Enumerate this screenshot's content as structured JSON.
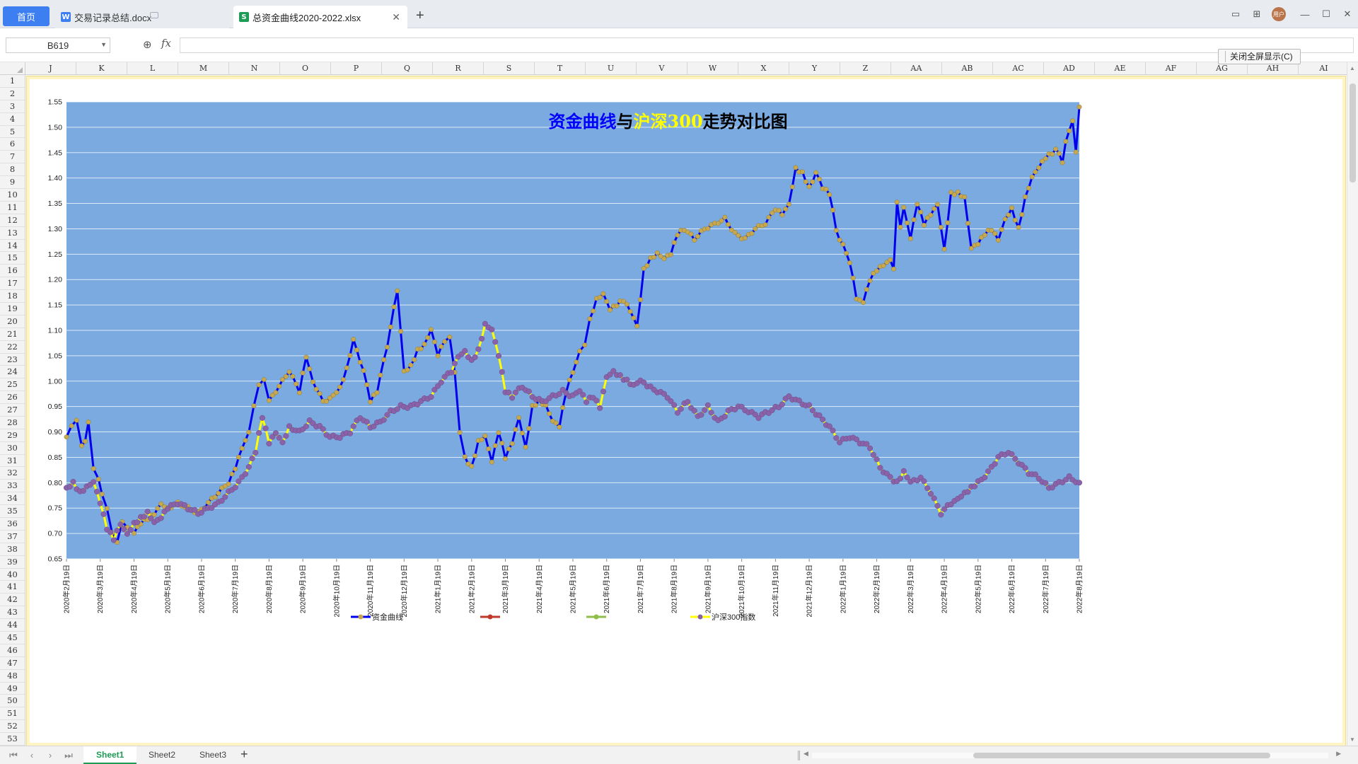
{
  "tabs": {
    "home": "首页",
    "doc": "交易记录总结.docx",
    "xls": "总资金曲线2020-2022.xlsx",
    "doc_badge": "W",
    "xls_badge": "S"
  },
  "window": {
    "avatar_text": "用户"
  },
  "formula_bar": {
    "name_box": "B619",
    "fx": "fx",
    "value": ""
  },
  "exit_fullscreen": "关闭全屏显示(C)",
  "columns": [
    "J",
    "K",
    "L",
    "M",
    "N",
    "O",
    "P",
    "Q",
    "R",
    "S",
    "T",
    "U",
    "V",
    "W",
    "X",
    "Y",
    "Z",
    "AA",
    "AB",
    "AC",
    "AD",
    "AE",
    "AF",
    "AG",
    "AH",
    "AI"
  ],
  "rows": [
    "1",
    "2",
    "3",
    "4",
    "5",
    "6",
    "7",
    "8",
    "9",
    "10",
    "11",
    "12",
    "13",
    "14",
    "15",
    "16",
    "17",
    "18",
    "19",
    "20",
    "21",
    "22",
    "23",
    "24",
    "25",
    "26",
    "27",
    "28",
    "29",
    "30",
    "31",
    "32",
    "33",
    "34",
    "35",
    "36",
    "37",
    "38",
    "39",
    "40",
    "41",
    "42",
    "43",
    "44",
    "45",
    "46",
    "47",
    "48",
    "49",
    "50",
    "51",
    "52",
    "53"
  ],
  "sheets": [
    "Sheet1",
    "Sheet2",
    "Sheet3"
  ],
  "colors": {
    "plot_bg": "#7aaae0",
    "fund_line": "#0000ee",
    "fund_marker": "#c8a84e",
    "index_line": "#ffff00",
    "index_marker": "#8a62a8",
    "title_blue": "#0000ff",
    "title_yellow": "#ffff00",
    "title_black": "#000000",
    "series2": "#c0392b",
    "series3": "#8fbf4a"
  },
  "chart_data": {
    "type": "line",
    "title_parts": [
      "资金曲线",
      "与",
      "沪深300",
      "走势对比图"
    ],
    "ylim": [
      0.65,
      1.55
    ],
    "y_ticks": [
      "1.55",
      "1.50",
      "1.45",
      "1.40",
      "1.35",
      "1.30",
      "1.25",
      "1.20",
      "1.15",
      "1.10",
      "1.05",
      "1.00",
      "0.95",
      "0.90",
      "0.85",
      "0.80",
      "0.75",
      "0.70",
      "0.65"
    ],
    "x_labels": [
      "2020年2月19日",
      "2020年3月19日",
      "2020年4月19日",
      "2020年5月19日",
      "2020年6月19日",
      "2020年7月19日",
      "2020年8月19日",
      "2020年9月19日",
      "2020年10月19日",
      "2020年11月19日",
      "2020年12月19日",
      "2021年1月19日",
      "2021年2月19日",
      "2021年3月19日",
      "2021年4月19日",
      "2021年5月19日",
      "2021年6月19日",
      "2021年7月19日",
      "2021年8月19日",
      "2021年9月19日",
      "2021年10月19日",
      "2021年11月19日",
      "2021年12月19日",
      "2022年1月19日",
      "2022年2月19日",
      "2022年3月19日",
      "2022年4月19日",
      "2022年5月19日",
      "2022年6月19日",
      "2022年7月19日",
      "2022年8月19日"
    ],
    "legend": [
      {
        "name": "资金曲线",
        "line": "#0000ee",
        "marker": "#c8a84e"
      },
      {
        "name": "",
        "line": "#c0392b",
        "marker": "#c0392b"
      },
      {
        "name": "",
        "line": "#8fbf4a",
        "marker": "#8fbf4a"
      },
      {
        "name": "沪深300指数",
        "line": "#ffff00",
        "marker": "#8a62a8"
      }
    ],
    "series": [
      {
        "name": "资金曲线",
        "x_month": [
          0,
          0.15,
          0.3,
          0.45,
          0.55,
          0.65,
          0.8,
          0.95,
          1.05,
          1.2,
          1.35,
          1.5,
          1.65,
          1.8,
          2.0,
          2.2,
          2.4,
          2.6,
          2.8,
          3.0,
          3.3,
          3.6,
          3.9,
          4.2,
          4.5,
          4.8,
          5.0,
          5.2,
          5.4,
          5.55,
          5.7,
          5.85,
          6.0,
          6.3,
          6.6,
          6.9,
          7.1,
          7.3,
          7.6,
          7.9,
          8.2,
          8.5,
          8.8,
          9.0,
          9.2,
          9.5,
          9.8,
          10.0,
          10.2,
          10.4,
          10.6,
          10.8,
          11.0,
          11.2,
          11.35,
          11.5,
          11.65,
          11.8,
          12.0,
          12.2,
          12.4,
          12.6,
          12.8,
          13.0,
          13.2,
          13.4,
          13.6,
          13.8,
          14.0,
          14.2,
          14.4,
          14.6,
          14.8,
          15.0,
          15.1,
          15.2,
          15.35,
          15.5,
          15.7,
          15.9,
          16.1,
          16.3,
          16.5,
          16.7,
          16.9,
          17.0,
          17.1,
          17.3,
          17.5,
          17.7,
          17.9,
          18.1,
          18.3,
          18.6,
          18.9,
          19.2,
          19.5,
          19.8,
          20.1,
          20.4,
          20.7,
          21.0,
          21.2,
          21.4,
          21.6,
          21.8,
          22.0,
          22.1,
          22.2,
          22.4,
          22.6,
          22.8,
          22.9,
          23.0,
          23.1,
          23.2,
          23.3,
          23.4,
          23.6,
          23.8,
          24.0,
          24.2,
          24.4,
          24.5,
          24.6,
          24.7,
          24.8,
          25.0,
          25.2,
          25.4,
          25.6,
          25.8,
          26.0,
          26.2,
          26.4,
          26.6,
          26.8,
          27.0,
          27.2,
          27.4,
          27.6,
          27.8,
          28.0,
          28.2,
          28.4,
          28.6,
          28.8,
          29.0,
          29.2,
          29.3,
          29.4,
          29.5,
          29.6,
          29.7,
          29.8,
          29.9,
          30.0
        ],
        "values": [
          0.89,
          0.91,
          0.92,
          0.87,
          0.88,
          0.92,
          0.83,
          0.81,
          0.78,
          0.75,
          0.7,
          0.68,
          0.72,
          0.71,
          0.7,
          0.72,
          0.73,
          0.74,
          0.76,
          0.75,
          0.76,
          0.75,
          0.74,
          0.76,
          0.78,
          0.8,
          0.83,
          0.87,
          0.9,
          0.95,
          0.99,
          1.0,
          0.96,
          0.99,
          1.02,
          0.98,
          1.05,
          1.0,
          0.96,
          0.97,
          1.0,
          1.08,
          1.02,
          0.96,
          0.98,
          1.07,
          1.18,
          1.02,
          1.03,
          1.06,
          1.07,
          1.1,
          1.05,
          1.08,
          1.09,
          1.02,
          0.9,
          0.85,
          0.83,
          0.88,
          0.89,
          0.84,
          0.9,
          0.85,
          0.88,
          0.93,
          0.87,
          0.95,
          0.96,
          0.95,
          0.92,
          0.91,
          0.98,
          1.02,
          1.04,
          1.06,
          1.07,
          1.12,
          1.16,
          1.17,
          1.14,
          1.15,
          1.16,
          1.14,
          1.11,
          1.16,
          1.22,
          1.24,
          1.25,
          1.24,
          1.25,
          1.29,
          1.3,
          1.28,
          1.3,
          1.31,
          1.32,
          1.29,
          1.28,
          1.3,
          1.31,
          1.34,
          1.33,
          1.35,
          1.42,
          1.41,
          1.38,
          1.39,
          1.41,
          1.38,
          1.37,
          1.3,
          1.28,
          1.27,
          1.25,
          1.23,
          1.2,
          1.16,
          1.155,
          1.2,
          1.22,
          1.23,
          1.24,
          1.22,
          1.35,
          1.3,
          1.34,
          1.28,
          1.35,
          1.31,
          1.33,
          1.35,
          1.26,
          1.37,
          1.37,
          1.36,
          1.26,
          1.27,
          1.29,
          1.3,
          1.28,
          1.32,
          1.34,
          1.3,
          1.36,
          1.4,
          1.42,
          1.44,
          1.45,
          1.46,
          1.45,
          1.43,
          1.47,
          1.49,
          1.51,
          1.45,
          1.54,
          1.545,
          1.54,
          1.53,
          1.51
        ],
        "line": "#0000ee",
        "marker": "#c8a84e"
      },
      {
        "name": "沪深300指数",
        "x_month": [
          0,
          0.2,
          0.4,
          0.6,
          0.8,
          1.0,
          1.2,
          1.4,
          1.6,
          1.8,
          2.0,
          2.2,
          2.4,
          2.6,
          2.8,
          3.0,
          3.3,
          3.6,
          3.9,
          4.2,
          4.5,
          4.8,
          5.1,
          5.4,
          5.6,
          5.8,
          6.0,
          6.2,
          6.4,
          6.6,
          6.9,
          7.2,
          7.5,
          7.8,
          8.1,
          8.4,
          8.7,
          9.0,
          9.3,
          9.6,
          9.9,
          10.2,
          10.5,
          10.8,
          11.1,
          11.4,
          11.6,
          11.8,
          12.0,
          12.2,
          12.4,
          12.6,
          12.8,
          13.0,
          13.2,
          13.5,
          13.8,
          14.1,
          14.4,
          14.7,
          15.0,
          15.2,
          15.4,
          15.6,
          15.8,
          16.0,
          16.2,
          16.4,
          16.6,
          16.8,
          17.0,
          17.2,
          17.5,
          17.8,
          18.1,
          18.4,
          18.7,
          19.0,
          19.3,
          19.6,
          19.9,
          20.2,
          20.5,
          20.8,
          21.1,
          21.4,
          21.7,
          22.0,
          22.3,
          22.6,
          22.9,
          23.2,
          23.5,
          23.8,
          24.1,
          24.4,
          24.6,
          24.8,
          25.0,
          25.3,
          25.6,
          25.9,
          26.2,
          26.4,
          26.6,
          26.8,
          27.0,
          27.3,
          27.6,
          27.9,
          28.2,
          28.5,
          28.8,
          29.1,
          29.4,
          29.7,
          30.0
        ],
        "values": [
          0.79,
          0.8,
          0.78,
          0.79,
          0.8,
          0.76,
          0.71,
          0.69,
          0.72,
          0.7,
          0.72,
          0.73,
          0.74,
          0.72,
          0.73,
          0.75,
          0.76,
          0.75,
          0.74,
          0.75,
          0.76,
          0.78,
          0.8,
          0.83,
          0.86,
          0.93,
          0.88,
          0.9,
          0.88,
          0.91,
          0.9,
          0.92,
          0.91,
          0.89,
          0.89,
          0.9,
          0.93,
          0.91,
          0.92,
          0.94,
          0.95,
          0.95,
          0.96,
          0.97,
          1.0,
          1.02,
          1.05,
          1.06,
          1.04,
          1.06,
          1.11,
          1.1,
          1.05,
          0.98,
          0.97,
          0.99,
          0.97,
          0.96,
          0.97,
          0.98,
          0.97,
          0.98,
          0.96,
          0.97,
          0.95,
          1.01,
          1.02,
          1.01,
          1.0,
          0.99,
          1.0,
          0.99,
          0.98,
          0.97,
          0.94,
          0.96,
          0.93,
          0.95,
          0.92,
          0.94,
          0.95,
          0.94,
          0.93,
          0.94,
          0.95,
          0.97,
          0.96,
          0.95,
          0.93,
          0.91,
          0.88,
          0.89,
          0.88,
          0.87,
          0.83,
          0.81,
          0.8,
          0.82,
          0.8,
          0.81,
          0.78,
          0.74,
          0.76,
          0.77,
          0.78,
          0.79,
          0.8,
          0.82,
          0.85,
          0.86,
          0.84,
          0.82,
          0.81,
          0.79,
          0.8,
          0.81,
          0.8
        ],
        "line": "#ffff00",
        "marker": "#8a62a8"
      }
    ]
  }
}
